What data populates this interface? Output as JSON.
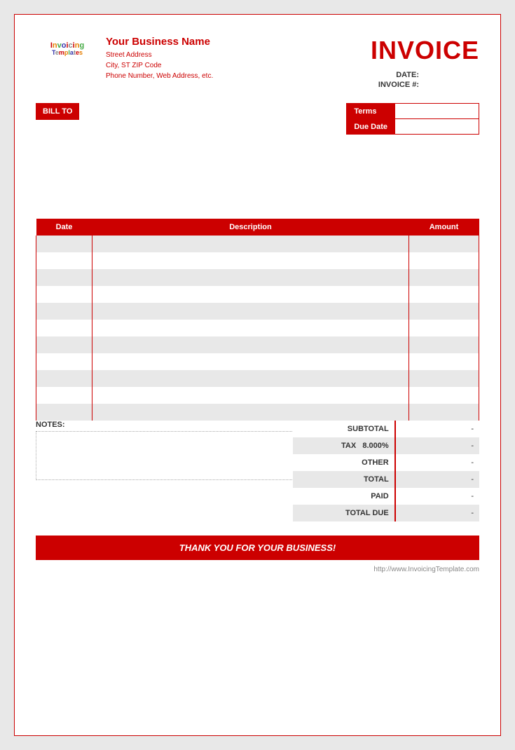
{
  "header": {
    "invoice_title": "INVOICE",
    "business_name": "Your Business Name",
    "street_address": "Street Address",
    "city_state_zip": "City, ST  ZIP Code",
    "phone_web": "Phone Number, Web Address, etc.",
    "date_label": "DATE:",
    "invoice_num_label": "INVOICE #:",
    "date_value": "",
    "invoice_num_value": ""
  },
  "logo": {
    "line1": "Invoicing",
    "line2": "Templates"
  },
  "bill_to": {
    "label": "BILL TO"
  },
  "terms": {
    "terms_label": "Terms",
    "terms_value": "",
    "due_date_label": "Due Date",
    "due_date_value": ""
  },
  "table": {
    "col_date": "Date",
    "col_description": "Description",
    "col_amount": "Amount",
    "rows": [
      {
        "date": "",
        "description": "",
        "amount": ""
      },
      {
        "date": "",
        "description": "",
        "amount": ""
      },
      {
        "date": "",
        "description": "",
        "amount": ""
      },
      {
        "date": "",
        "description": "",
        "amount": ""
      },
      {
        "date": "",
        "description": "",
        "amount": ""
      },
      {
        "date": "",
        "description": "",
        "amount": ""
      },
      {
        "date": "",
        "description": "",
        "amount": ""
      },
      {
        "date": "",
        "description": "",
        "amount": ""
      },
      {
        "date": "",
        "description": "",
        "amount": ""
      },
      {
        "date": "",
        "description": "",
        "amount": ""
      },
      {
        "date": "",
        "description": "",
        "amount": ""
      }
    ]
  },
  "totals": {
    "subtotal_label": "SUBTOTAL",
    "subtotal_value": "-",
    "tax_label": "TAX",
    "tax_rate": "8.000%",
    "tax_value": "-",
    "other_label": "OTHER",
    "other_value": "-",
    "total_label": "TOTAL",
    "total_value": "-",
    "paid_label": "PAID",
    "paid_value": "-",
    "total_due_label": "TOTAL DUE",
    "total_due_value": "-"
  },
  "notes": {
    "label": "NOTES:",
    "value": ""
  },
  "footer": {
    "thank_you": "THANK YOU FOR YOUR BUSINESS!",
    "url": "http://www.InvoicingTemplate.com"
  }
}
